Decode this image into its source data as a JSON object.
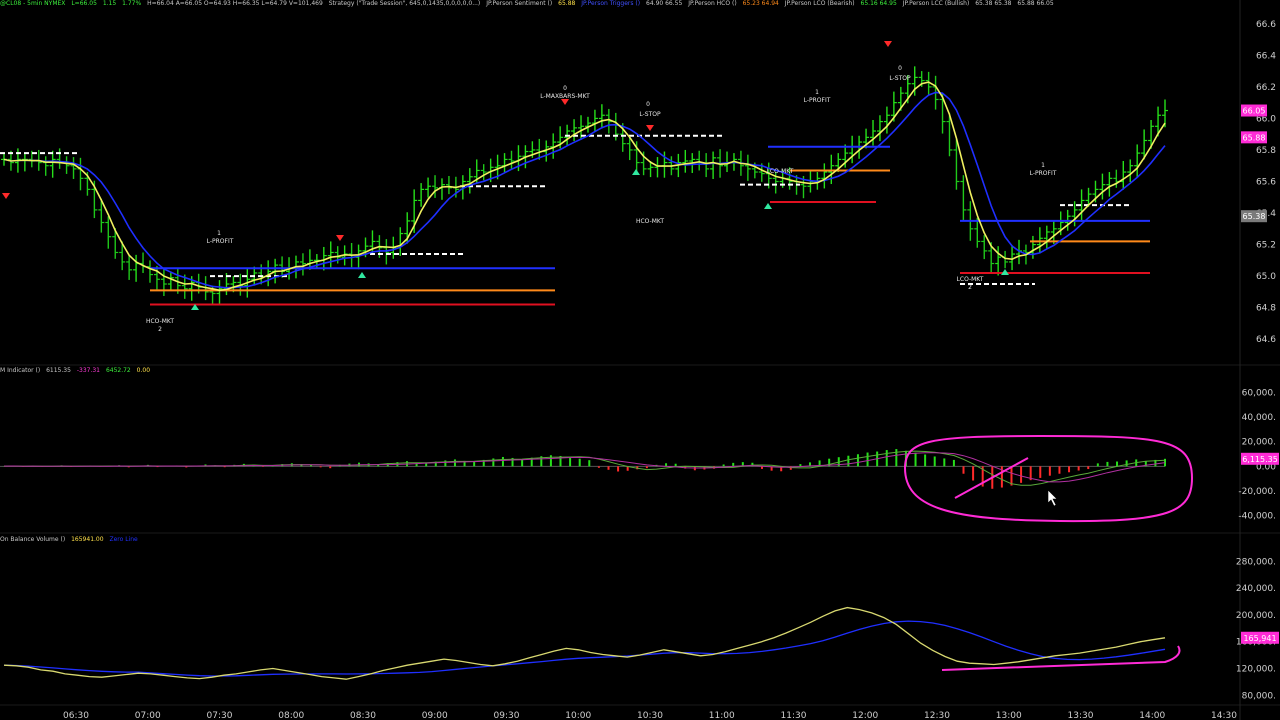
{
  "header": {
    "symbol": "@CL08 - 5min NYMEX",
    "last": "L=66.05",
    "change": "1.15",
    "change_pct": "1.77%",
    "hi_lo": "H=66.04  A=66.05  O=64.93  H=66.35  L=64.79  V=101,469",
    "strategy": "Strategy (\"Trade Session\", 645,0,1435,0,0,0,0,0...)",
    "study1": "JP.Person Sentiment ()",
    "study1_val": "65.88",
    "study2": "JP.Person Triggers ()",
    "study2_val": "64.90  66.55",
    "study3": "JP.Person HCO ()",
    "study3_val": "65.23  64.94",
    "study4": "JP.Person LCO (Bearish)",
    "study4_val": "65.16  64.95",
    "study5": "JP.Person LCC (Bullish)",
    "study5_val": "65.38  65.38",
    "study6_val": "65.88  66.05"
  },
  "indicator_header": {
    "name": "M Indicator ()",
    "val1": "6115.35",
    "val2": "-337.31",
    "val3": "6452.72",
    "val4": "0.00"
  },
  "obv_header": {
    "name": "On Balance Volume ()",
    "val1": "165941.00",
    "val2": "Zero Line"
  },
  "colors": {
    "up_bar": "#26e01a",
    "down_bar": "#ff2a2a",
    "fast_ma": "#f0f060",
    "slow_ma": "#1f2fff",
    "level_blue": "#2030ff",
    "level_orange": "#ff8a1a",
    "level_red": "#e01020",
    "annotation": "#ff2bd6",
    "axis_text": "#cfcfcf"
  },
  "chart_data": [
    {
      "type": "line",
      "panel": "price",
      "y_ticks": [
        "66.6",
        "66.4",
        "66.2",
        "66.0",
        "65.8",
        "65.6",
        "65.4",
        "65.2",
        "65.0",
        "64.8",
        "64.6"
      ],
      "ylim": [
        64.5,
        66.7
      ],
      "x_ticks": [
        "06:30",
        "07:00",
        "07:30",
        "08:00",
        "08:30",
        "09:00",
        "09:30",
        "10:00",
        "10:30",
        "11:00",
        "11:30",
        "12:00",
        "12:30",
        "13:00",
        "13:30",
        "14:00",
        "14:30"
      ],
      "right_tags": [
        {
          "text": "66.05",
          "value": 66.05,
          "color": "#ff2bd6"
        },
        {
          "text": "65.88",
          "value": 65.88,
          "color": "#ff2bd6"
        },
        {
          "text": "65.38",
          "value": 65.38,
          "color": "#7a7a7a"
        }
      ],
      "series": [
        {
          "name": "",
          "values": [
            65.74,
            65.72,
            65.74,
            65.74,
            65.73,
            65.72,
            65.7,
            65.74,
            65.72,
            65.7,
            65.68,
            65.62,
            65.55,
            65.42,
            65.34,
            65.25,
            65.15,
            65.09,
            65.04,
            65.08,
            65.06,
            65.01,
            64.98,
            64.95,
            64.99,
            64.94,
            64.92,
            64.96,
            64.93,
            64.9,
            64.89,
            64.92,
            64.95,
            64.96,
            64.94,
            64.98,
            65.02,
            65.0,
            65.03,
            65.07,
            65.03,
            65.05,
            65.09,
            65.08,
            65.1,
            65.1,
            65.13,
            65.15,
            65.12,
            65.14,
            65.12,
            65.16,
            65.19,
            65.22,
            65.18,
            65.15,
            65.18,
            65.27,
            65.35,
            65.48,
            65.55,
            65.57,
            65.56,
            65.58,
            65.56,
            65.55,
            65.6,
            65.63,
            65.67,
            65.66,
            65.69,
            65.7,
            65.74,
            65.73,
            65.76,
            65.79,
            65.8,
            65.79,
            65.82,
            65.85,
            65.88,
            65.92,
            65.94,
            65.95,
            65.97,
            66.0,
            66.02,
            65.98,
            65.9,
            65.84,
            65.8,
            65.72,
            65.68,
            65.69,
            65.7,
            65.72,
            65.68,
            65.72,
            65.73,
            65.74,
            65.71,
            65.68,
            65.75,
            65.7,
            65.72,
            65.74,
            65.7,
            65.68,
            65.66,
            65.65,
            65.62,
            65.6,
            65.62,
            65.6,
            65.58,
            65.57,
            65.6,
            65.62,
            65.66,
            65.7,
            65.74,
            65.78,
            65.82,
            65.85,
            65.88,
            65.92,
            65.98,
            66.02,
            66.1,
            66.16,
            66.22,
            66.26,
            66.24,
            66.2,
            66.12,
            65.98,
            65.8,
            65.6,
            65.42,
            65.3,
            65.22,
            65.16,
            65.08,
            65.12,
            65.09,
            65.14,
            65.16,
            65.15,
            65.2,
            65.24,
            65.28,
            65.3,
            65.34,
            65.38,
            65.42,
            65.48,
            65.52,
            65.55,
            65.58,
            65.62,
            65.6,
            65.66,
            65.7,
            65.78,
            65.86,
            65.95,
            66.02,
            66.05
          ]
        }
      ]
    },
    {
      "type": "bar",
      "panel": "indicator",
      "y_ticks": [
        "60,000.",
        "40,000.",
        "20,000.",
        "0.00",
        "-20,000.",
        "-40,000."
      ],
      "ylim": [
        -50000,
        70000
      ],
      "right_tags": [
        {
          "text": "6,115.35",
          "value": 6115.35,
          "color": "#ff2bd6"
        }
      ],
      "series": [
        {
          "name": "",
          "values": [
            200,
            300,
            -400,
            500,
            -300,
            200,
            800,
            -500,
            300,
            600,
            -200,
            400,
            900,
            -800,
            500,
            1200,
            -600,
            400,
            700,
            -900,
            600,
            1500,
            800,
            -700,
            1200,
            2000,
            1500,
            -400,
            900,
            1800,
            2500,
            1900,
            1400,
            -800,
            -1500,
            1200,
            2200,
            3000,
            2400,
            1800,
            2600,
            3400,
            4200,
            3000,
            2500,
            3800,
            4800,
            5600,
            4400,
            3900,
            5200,
            6400,
            7600,
            6800,
            5400,
            7000,
            8200,
            9000,
            8400,
            7600,
            6200,
            5000,
            -1200,
            -2800,
            -4200,
            -3600,
            -2400,
            -1500,
            1200,
            2500,
            2100,
            -1800,
            -3200,
            -2600,
            -1900,
            1500,
            2800,
            3400,
            2900,
            -2100,
            -3500,
            -4000,
            -2800,
            1800,
            3200,
            4800,
            6200,
            7400,
            8600,
            9800,
            11200,
            12000,
            13200,
            14000,
            12600,
            11000,
            9600,
            8000,
            6400,
            5200,
            -6000,
            -11500,
            -16400,
            -18200,
            -17200,
            -15600,
            -13400,
            -11200,
            -9400,
            -7600,
            -6000,
            -4800,
            -3400,
            -2200,
            2400,
            3600,
            3900,
            4800,
            5600,
            4200,
            5200,
            6100
          ]
        }
      ]
    },
    {
      "type": "line",
      "panel": "obv",
      "y_ticks": [
        "280,000.",
        "240,000.",
        "200,000.",
        "160,000.",
        "120,000.",
        "80,000."
      ],
      "ylim": [
        70000,
        300000
      ],
      "right_tags": [
        {
          "text": "165,941",
          "value": 165941,
          "color": "#ff2bd6"
        }
      ],
      "series": [
        {
          "name": "",
          "values": [
            125000,
            124000,
            122000,
            118000,
            116000,
            112000,
            110000,
            108000,
            107000,
            109000,
            111000,
            113000,
            112000,
            110000,
            108000,
            106000,
            105000,
            107000,
            110000,
            112000,
            115000,
            118000,
            120000,
            117000,
            114000,
            111000,
            108000,
            106000,
            104000,
            108000,
            112000,
            117000,
            121000,
            125000,
            128000,
            131000,
            134000,
            132000,
            129000,
            126000,
            124000,
            127000,
            131000,
            136000,
            141000,
            146000,
            150000,
            148000,
            144000,
            141000,
            139000,
            137000,
            140000,
            144000,
            148000,
            145000,
            142000,
            139000,
            141000,
            145000,
            150000,
            155000,
            160000,
            166000,
            173000,
            181000,
            189000,
            198000,
            206000,
            211000,
            208000,
            203000,
            196000,
            186000,
            172000,
            158000,
            147000,
            138000,
            131000,
            128000,
            127000,
            126000,
            128000,
            130000,
            133000,
            136000,
            139000,
            141000,
            143000,
            146000,
            149000,
            152000,
            156000,
            160000,
            163000,
            165941
          ]
        }
      ]
    }
  ],
  "annotations": {
    "price_labels": [
      "L-PROFIT",
      "1",
      "HCO-MKT",
      "2",
      "L-MAXBARS-MKT",
      "0",
      "L-STOP",
      "0",
      "HCO-MKT",
      "L-PROFIT",
      "1",
      "LCO-MKT",
      "0",
      "L-STOP",
      "L-PROFIT",
      "1",
      "LCO-MKT",
      "2"
    ]
  }
}
